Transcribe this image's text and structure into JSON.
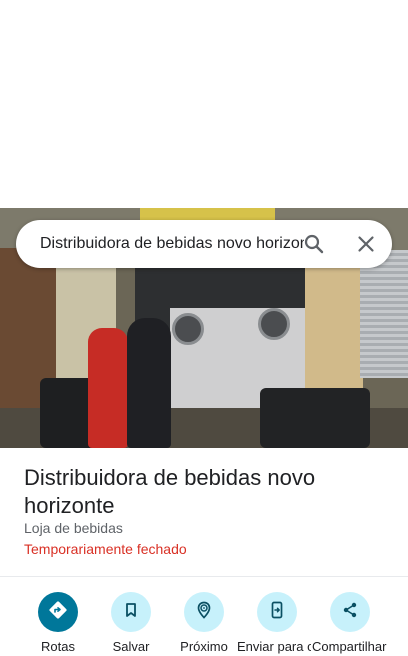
{
  "search": {
    "query": "Distribuidora de bebidas novo horizonte"
  },
  "place": {
    "title": "Distribuidora de bebidas novo horizonte",
    "category": "Loja de bebidas",
    "status": "Temporariamente fechado"
  },
  "actions": [
    {
      "label": "Rotas",
      "icon": "directions-icon"
    },
    {
      "label": "Salvar",
      "icon": "bookmark-icon"
    },
    {
      "label": "Próximo",
      "icon": "nearby-icon"
    },
    {
      "label": "Enviar para o telefone",
      "icon": "send-to-phone-icon"
    },
    {
      "label": "Compartilhar",
      "icon": "share-icon"
    }
  ],
  "colors": {
    "accent": "#00779a",
    "action_bg": "#c7f1fb",
    "status_closed": "#d93025"
  }
}
